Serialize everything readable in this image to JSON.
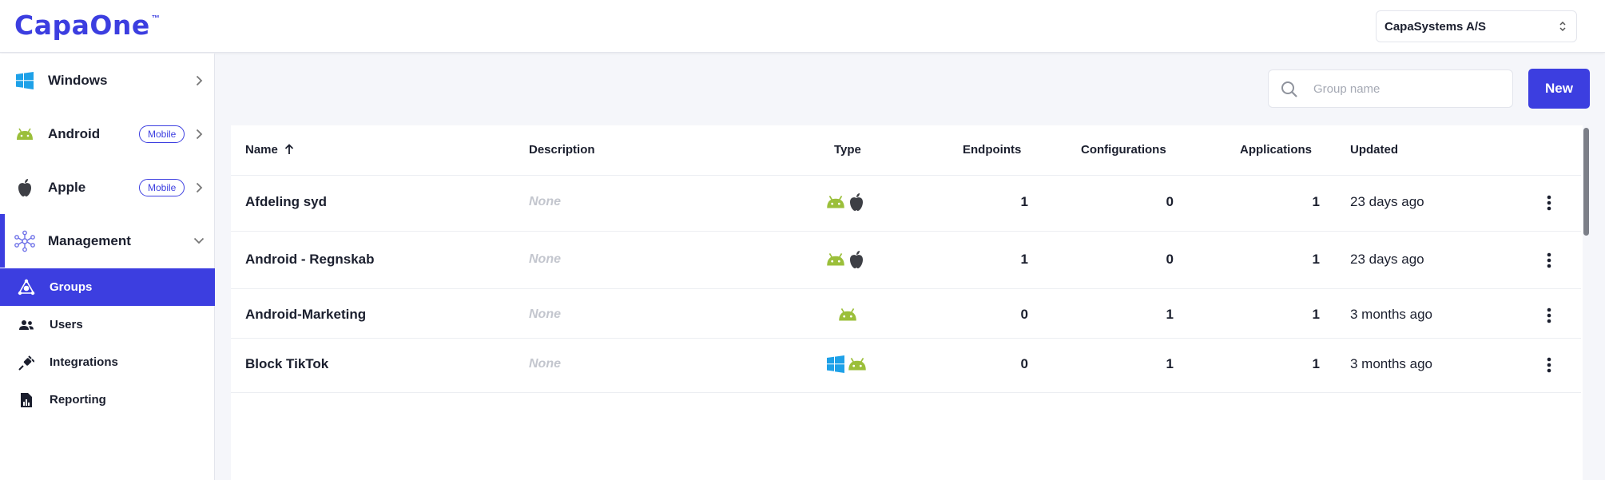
{
  "header": {
    "logo_text": "CapaOne",
    "logo_tm": "™",
    "company": "CapaSystems A/S"
  },
  "sidebar": {
    "items": [
      {
        "label": "Windows",
        "icon": "windows-icon"
      },
      {
        "label": "Android",
        "icon": "android-icon",
        "badge": "Mobile"
      },
      {
        "label": "Apple",
        "icon": "apple-icon",
        "badge": "Mobile"
      },
      {
        "label": "Management",
        "icon": "network-icon"
      }
    ],
    "subitems": [
      {
        "label": "Groups",
        "icon": "groups-icon"
      },
      {
        "label": "Users",
        "icon": "users-icon"
      },
      {
        "label": "Integrations",
        "icon": "plug-icon"
      },
      {
        "label": "Reporting",
        "icon": "report-icon"
      }
    ]
  },
  "toolbar": {
    "search_placeholder": "Group name",
    "new_label": "New"
  },
  "table": {
    "columns": {
      "name": "Name",
      "description": "Description",
      "type": "Type",
      "endpoints": "Endpoints",
      "configurations": "Configurations",
      "applications": "Applications",
      "updated": "Updated"
    },
    "rows": [
      {
        "name": "Afdeling syd",
        "description": "None",
        "types": [
          "android-icon",
          "apple-icon"
        ],
        "endpoints": "1",
        "configurations": "0",
        "applications": "1",
        "updated": "23 days ago"
      },
      {
        "name": "Android - Regnskab",
        "description": "None",
        "types": [
          "android-icon",
          "apple-icon"
        ],
        "endpoints": "1",
        "configurations": "0",
        "applications": "1",
        "updated": "23 days ago"
      },
      {
        "name": "Android-Marketing",
        "description": "None",
        "types": [
          "android-icon"
        ],
        "endpoints": "0",
        "configurations": "1",
        "applications": "1",
        "updated": "3 months ago"
      },
      {
        "name": "Block TikTok",
        "description": "None",
        "types": [
          "windows-icon",
          "android-icon"
        ],
        "endpoints": "0",
        "configurations": "1",
        "applications": "1",
        "updated": "3 months ago"
      }
    ]
  },
  "colors": {
    "accent": "#3c3ee0",
    "android": "#9bbf3a",
    "windows": "#1ea1e8",
    "apple": "#3d3f45"
  }
}
